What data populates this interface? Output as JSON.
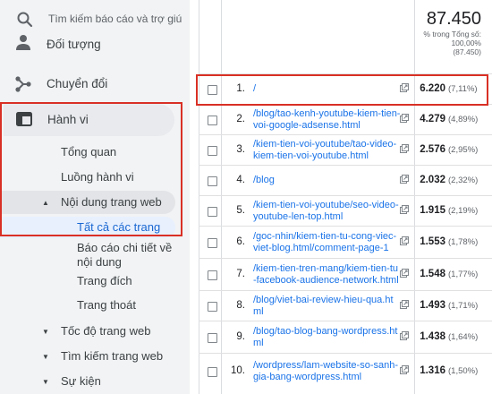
{
  "search": {
    "placeholder": "Tìm kiếm báo cáo và trợ giú"
  },
  "sidebar": {
    "audience": "Đối tượng",
    "conversions": "Chuyển đổi",
    "behavior": "Hành vi",
    "behavior_items": {
      "overview": "Tổng quan",
      "flow": "Luồng hành vi",
      "site_content": "Nội dung trang web",
      "all_pages": "Tất cả các trang",
      "content_drilldown": "Báo cáo chi tiết về nội dung",
      "landing_pages": "Trang đích",
      "exit_pages": "Trang thoát",
      "site_speed": "Tốc độ trang web",
      "site_search": "Tìm kiếm trang web",
      "events": "Sự kiện"
    }
  },
  "table": {
    "total_value": "87.450",
    "total_caption_1": "% trong Tổng số:",
    "total_caption_2": "100,00%",
    "total_caption_3": "(87.450)",
    "rows": [
      {
        "idx": "1.",
        "page": "/",
        "value": "6.220",
        "pct": "(7,11%)"
      },
      {
        "idx": "2.",
        "page": "/blog/tao-kenh-youtube-kiem-tien-voi-google-adsense.html",
        "value": "4.279",
        "pct": "(4,89%)"
      },
      {
        "idx": "3.",
        "page": "/kiem-tien-voi-youtube/tao-video-kiem-tien-voi-youtube.html",
        "value": "2.576",
        "pct": "(2,95%)"
      },
      {
        "idx": "4.",
        "page": "/blog",
        "value": "2.032",
        "pct": "(2,32%)"
      },
      {
        "idx": "5.",
        "page": "/kiem-tien-voi-youtube/seo-video-youtube-len-top.html",
        "value": "1.915",
        "pct": "(2,19%)"
      },
      {
        "idx": "6.",
        "page": "/goc-nhin/kiem-tien-tu-cong-viec-viet-blog.html/comment-page-1",
        "value": "1.553",
        "pct": "(1,78%)"
      },
      {
        "idx": "7.",
        "page": "/kiem-tien-tren-mang/kiem-tien-tu-facebook-audience-network.html",
        "value": "1.548",
        "pct": "(1,77%)"
      },
      {
        "idx": "8.",
        "page": "/blog/viet-bai-review-hieu-qua.html",
        "value": "1.493",
        "pct": "(1,71%)"
      },
      {
        "idx": "9.",
        "page": "/blog/tao-blog-bang-wordpress.html",
        "value": "1.438",
        "pct": "(1,64%)"
      },
      {
        "idx": "10.",
        "page": "/wordpress/lam-website-so-sanh-gia-bang-wordpress.html",
        "value": "1.316",
        "pct": "(1,50%)"
      }
    ]
  }
}
